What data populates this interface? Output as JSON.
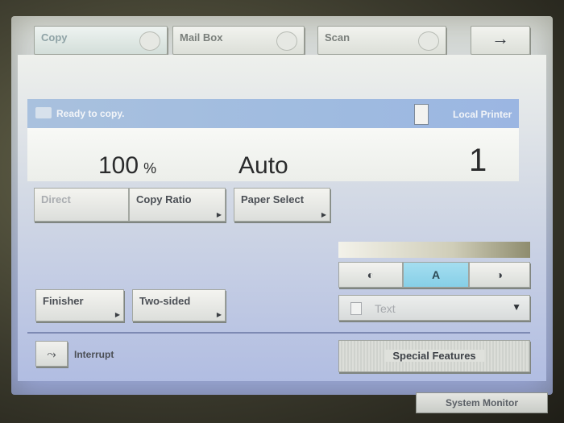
{
  "tabs": [
    {
      "label": "Copy",
      "icon": "copy-tab-icon"
    },
    {
      "label": "Mail Box",
      "icon": "mailbox-tab-icon"
    },
    {
      "label": "Scan",
      "icon": "scan-tab-icon"
    },
    {
      "label": "→",
      "icon": "arrow-right-icon"
    }
  ],
  "status": {
    "message": "Ready to copy.",
    "printer": "Local Printer"
  },
  "readout": {
    "ratio": "100",
    "ratio_unit": "%",
    "paper": "Auto",
    "copies": "1"
  },
  "buttons": {
    "direct": "Direct",
    "copy_ratio": "Copy Ratio",
    "paper_select": "Paper Select",
    "finisher": "Finisher",
    "two_sided": "Two-sided",
    "interrupt": "Interrupt",
    "special_features": "Special Features",
    "system_monitor": "System Monitor"
  },
  "density": {
    "lighter": "◐",
    "auto": "A",
    "darker": "◑",
    "selected": "A"
  },
  "original_type": {
    "value": "Text"
  },
  "colors": {
    "accent_selected": "#86cfe7",
    "status_bar": "#9fbbe0"
  }
}
